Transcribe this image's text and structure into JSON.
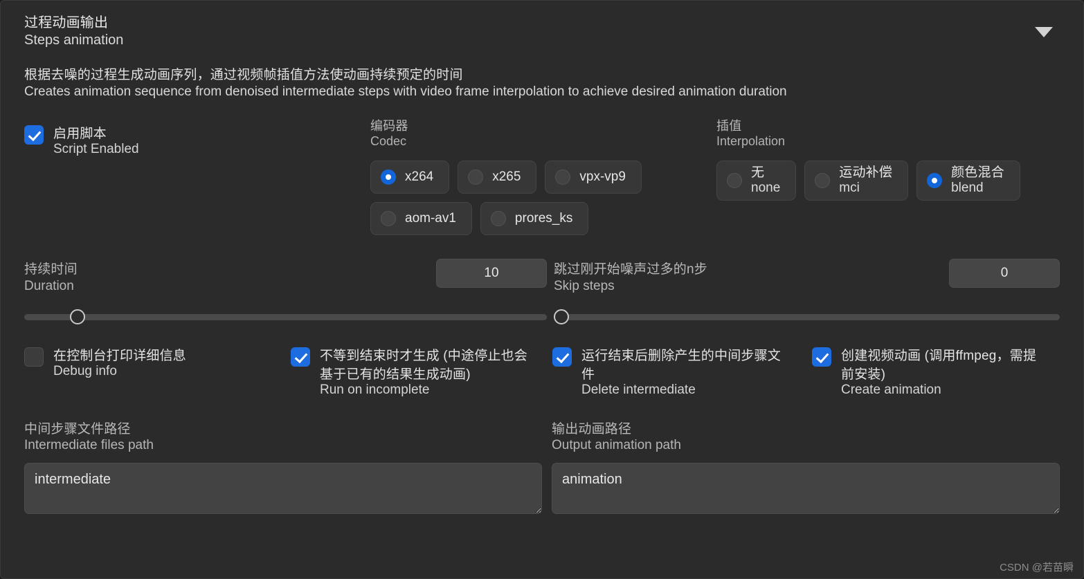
{
  "panel": {
    "title_zh": "过程动画输出",
    "title_en": "Steps animation",
    "collapse_icon": "chevron-down-icon",
    "description_zh": "根据去噪的过程生成动画序列，通过视频帧插值方法使动画持续预定的时间",
    "description_en": "Creates animation sequence from denoised intermediate steps with video frame interpolation to achieve desired animation duration"
  },
  "script_enabled": {
    "zh": "启用脚本",
    "en": "Script Enabled",
    "checked": true
  },
  "codec": {
    "label_zh": "编码器",
    "label_en": "Codec",
    "selected": "x264",
    "options": [
      {
        "en": "x264",
        "zh": "",
        "selected": true
      },
      {
        "en": "x265",
        "zh": "",
        "selected": false
      },
      {
        "en": "vpx-vp9",
        "zh": "",
        "selected": false
      },
      {
        "en": "aom-av1",
        "zh": "",
        "selected": false
      },
      {
        "en": "prores_ks",
        "zh": "",
        "selected": false
      }
    ]
  },
  "interpolation": {
    "label_zh": "插值",
    "label_en": "Interpolation",
    "selected": "blend",
    "options": [
      {
        "zh": "无",
        "en": "none",
        "selected": false
      },
      {
        "zh": "运动补偿",
        "en": "mci",
        "selected": false
      },
      {
        "zh": "颜色混合",
        "en": "blend",
        "selected": true
      }
    ]
  },
  "duration": {
    "label_zh": "持续时间",
    "label_en": "Duration",
    "value": "10",
    "slider_percent": 9
  },
  "skip_steps": {
    "label_zh": "跳过刚开始噪声过多的n步",
    "label_en": "Skip steps",
    "value": "0",
    "slider_percent": 0
  },
  "toggles": [
    {
      "zh": "在控制台打印详细信息",
      "en": "Debug info",
      "checked": false
    },
    {
      "zh": "不等到结束时才生成 (中途停止也会基于已有的结果生成动画)",
      "en": "Run on incomplete",
      "checked": true
    },
    {
      "zh": "运行结束后删除产生的中间步骤文件",
      "en": "Delete intermediate",
      "checked": true
    },
    {
      "zh": "创建视频动画 (调用ffmpeg，需提前安装)",
      "en": "Create animation",
      "checked": true
    }
  ],
  "intermediate_path": {
    "label_zh": "中间步骤文件路径",
    "label_en": "Intermediate files path",
    "value": "intermediate",
    "placeholder": ""
  },
  "output_path": {
    "label_zh": "输出动画路径",
    "label_en": "Output animation path",
    "value": "animation",
    "placeholder": ""
  },
  "watermark": "CSDN @若苗瞬"
}
